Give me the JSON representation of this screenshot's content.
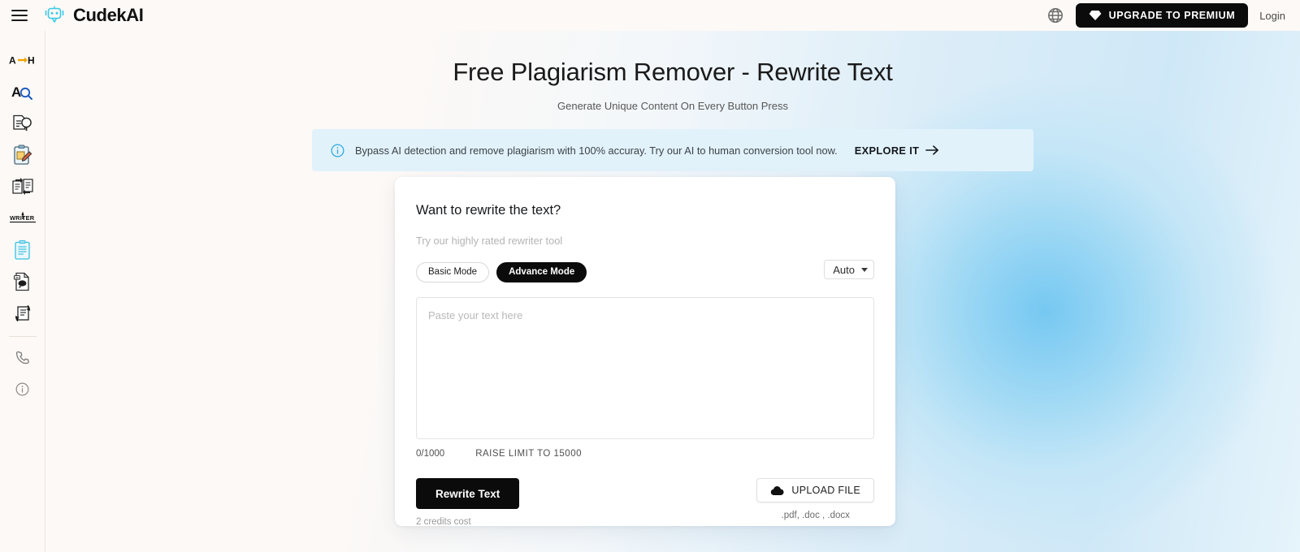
{
  "header": {
    "menu_icon": "hamburger-icon",
    "brand_name": "CudekAI",
    "logo_icon": "robot-icon",
    "language_icon": "globe-icon",
    "premium_button": "UPGRADE TO PREMIUM",
    "premium_icon": "diamond-icon",
    "login_label": "Login",
    "accent_color": "#3ac9e8",
    "premium_bg": "#0b0b0b"
  },
  "sidebar": {
    "items": [
      {
        "icon": "ai-to-human-icon",
        "label": "A→H"
      },
      {
        "icon": "ai-detector-icon",
        "label": "AI Detector"
      },
      {
        "icon": "plagiarism-checker-icon",
        "label": "Plagiarism Checker"
      },
      {
        "icon": "content-writer-icon",
        "label": "Content Writer"
      },
      {
        "icon": "paraphraser-icon",
        "label": "Paraphraser"
      },
      {
        "icon": "writer-text-icon",
        "label": "WRITER"
      },
      {
        "icon": "summarizer-icon",
        "label": "Summarizer"
      },
      {
        "icon": "pdf-chat-icon",
        "label": "Chat with PDF"
      },
      {
        "icon": "rewriter-icon",
        "label": "Rewriter"
      }
    ],
    "footer_items": [
      {
        "icon": "phone-icon",
        "label": "Contact"
      },
      {
        "icon": "info-icon",
        "label": "About"
      }
    ]
  },
  "hero": {
    "title": "Free Plagiarism Remover - Rewrite Text",
    "subtitle": "Generate Unique Content On Every Button Press"
  },
  "banner": {
    "icon": "info-circle-icon",
    "text": "Bypass AI detection and remove plagiarism with 100% accuray. Try our AI to human conversion tool now.",
    "cta": "EXPLORE IT",
    "cta_icon": "arrow-right-icon",
    "bg_color": "#e2f2fb"
  },
  "card": {
    "title": "Want to rewrite the text?",
    "subtitle": "Try our highly rated rewriter tool",
    "modes": {
      "basic": "Basic Mode",
      "advance": "Advance Mode",
      "active": "Advance Mode"
    },
    "language_select": {
      "value": "Auto",
      "icon": "chevron-down-icon"
    },
    "textarea": {
      "placeholder": "Paste your text here",
      "value": ""
    },
    "counter": "0/1000",
    "raise_limit": "RAISE LIMIT TO 15000",
    "rewrite_button": "Rewrite Text",
    "credits_note": "2 credits cost",
    "upload_button": "UPLOAD FILE",
    "upload_icon": "cloud-upload-icon",
    "upload_hint": ".pdf, .doc , .docx"
  }
}
